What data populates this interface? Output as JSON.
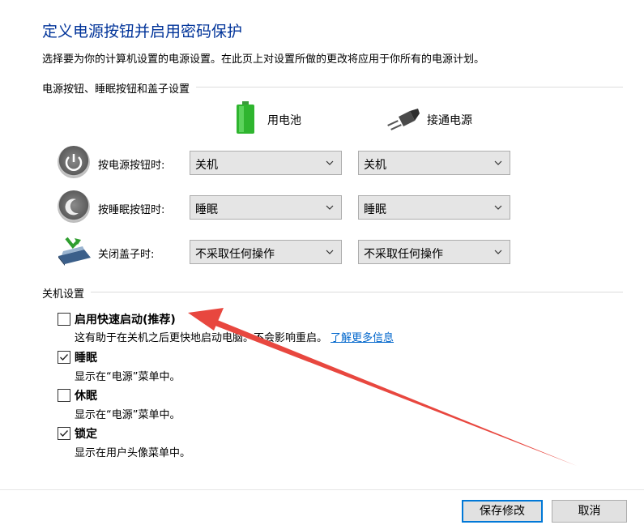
{
  "title": "定义电源按钮并启用密码保护",
  "subtitle": "选择要为你的计算机设置的电源设置。在此页上对设置所做的更改将应用于你所有的电源计划。",
  "power_section": {
    "heading": "电源按钮、睡眠按钮和盖子设置",
    "col_battery": "用电池",
    "col_plugged": "接通电源",
    "rows": [
      {
        "label": "按电源按钮时:",
        "icon": "power-icon",
        "battery": "关机",
        "plugged": "关机"
      },
      {
        "label": "按睡眠按钮时:",
        "icon": "sleep-moon-icon",
        "battery": "睡眠",
        "plugged": "睡眠"
      },
      {
        "label": "关闭盖子时:",
        "icon": "laptop-lid-icon",
        "battery": "不采取任何操作",
        "plugged": "不采取任何操作"
      }
    ]
  },
  "shutdown_section": {
    "heading": "关机设置",
    "items": [
      {
        "label": "启用快速启动(推荐)",
        "checked": false,
        "desc": "这有助于在关机之后更快地启动电脑。不会影响重启。",
        "link": "了解更多信息"
      },
      {
        "label": "睡眠",
        "checked": true,
        "desc": "显示在“电源”菜单中。"
      },
      {
        "label": "休眠",
        "checked": false,
        "desc": "显示在“电源”菜单中。"
      },
      {
        "label": "锁定",
        "checked": true,
        "desc": "显示在用户头像菜单中。"
      }
    ]
  },
  "footer": {
    "save": "保存修改",
    "cancel": "取消"
  },
  "colors": {
    "title": "#003399",
    "link": "#0066cc",
    "annotation_arrow": "#e8473f"
  }
}
